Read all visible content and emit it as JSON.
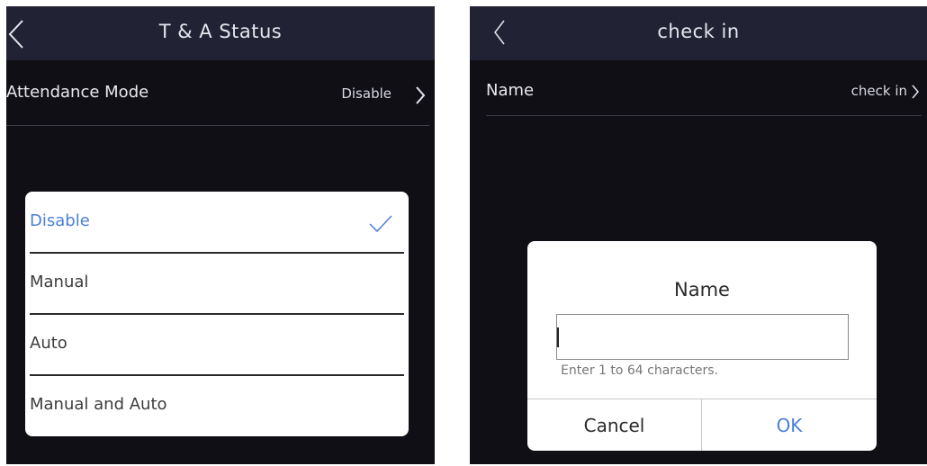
{
  "left": {
    "title": "T & A Status",
    "mode_row": {
      "label": "Attendance Mode",
      "value": "Disable"
    },
    "dropdown": {
      "options": [
        {
          "label": "Disable",
          "selected": true
        },
        {
          "label": "Manual",
          "selected": false
        },
        {
          "label": "Auto",
          "selected": false
        },
        {
          "label": "Manual and Auto",
          "selected": false
        }
      ]
    }
  },
  "right": {
    "title": "check in",
    "name_row": {
      "label": "Name",
      "value": "check in"
    },
    "dialog": {
      "title": "Name",
      "input_value": "",
      "hint": "Enter 1 to 64 characters.",
      "cancel_label": "Cancel",
      "ok_label": "OK"
    }
  },
  "colors": {
    "background": "#0f0f15",
    "header": "#222235",
    "accent": "#4a7fd6"
  },
  "icons": {
    "back": "back-chevron-icon",
    "forward": "chevron-right-icon",
    "check": "check-icon"
  }
}
